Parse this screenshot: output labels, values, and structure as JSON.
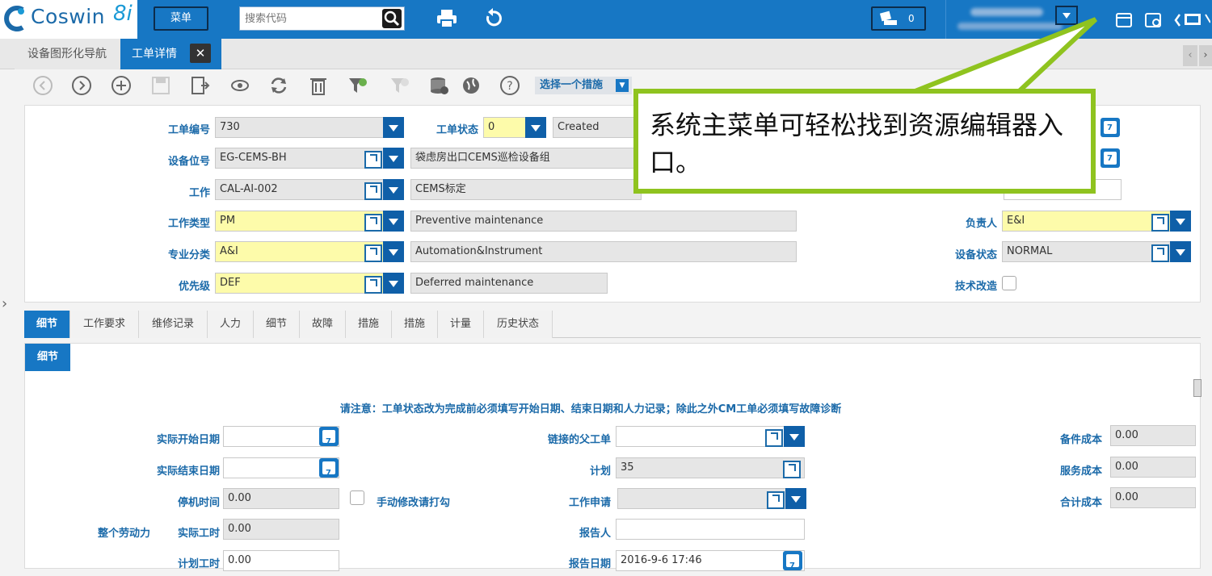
{
  "topbar": {
    "logo_text": "Coswin",
    "logo_version": "8i",
    "menu_label": "菜单",
    "search_placeholder": "搜索代码",
    "notification_count": "0"
  },
  "tabs": {
    "tab1": "设备图形化导航",
    "tab2": "工单详情",
    "close": "✕"
  },
  "toolbar": {
    "action_select": "选择一个措施"
  },
  "form": {
    "wo_number_label": "工单编号",
    "wo_number_value": "730",
    "wo_status_label": "工单状态",
    "wo_status_code": "0",
    "wo_status_text": "Created",
    "location_label": "设备位号",
    "location_code": "EG-CEMS-BH",
    "location_desc": "袋虑房出口CEMS巡检设备组",
    "job_label": "工作",
    "job_code": "CAL-AI-002",
    "job_desc": "CEMS标定",
    "job_type_label": "工作类型",
    "job_type_code": "PM",
    "job_type_desc": "Preventive maintenance",
    "discipline_label": "专业分类",
    "discipline_code": "A&I",
    "discipline_desc": "Automation&Instrument",
    "priority_label": "优先级",
    "priority_code": "DEF",
    "priority_desc": "Deferred maintenance",
    "owner_label": "负责人",
    "owner_value": "E&I",
    "equip_status_label": "设备状态",
    "equip_status_value": "NORMAL",
    "tech_mod_label": "技术改造"
  },
  "bottom_tabs": [
    "细节",
    "工作要求",
    "维修记录",
    "人力",
    "细节",
    "故障",
    "措施",
    "措施",
    "计量",
    "历史状态"
  ],
  "detail": {
    "subtab": "细节",
    "notice": "请注意：工单状态改为完成前必须填写开始日期、结束日期和人力记录；除此之外CM工单必须填写故障诊断",
    "actual_start_label": "实际开始日期",
    "actual_end_label": "实际结束日期",
    "downtime_label": "停机时间",
    "downtime_value": "0.00",
    "manual_check_label": "手动修改请打勾",
    "labor_group_label": "整个劳动力",
    "actual_hours_label": "实际工时",
    "actual_hours_value": "0.00",
    "plan_hours_label": "计划工时",
    "plan_hours_value": "0.00",
    "parent_wo_label": "链接的父工单",
    "plan_label": "计划",
    "plan_value": "35",
    "request_label": "工作申请",
    "reporter_label": "报告人",
    "report_date_label": "报告日期",
    "report_date_value": "2016-9-6 17:46",
    "parts_cost_label": "备件成本",
    "parts_cost_value": "0.00",
    "service_cost_label": "服务成本",
    "service_cost_value": "0.00",
    "total_cost_label": "合计成本",
    "total_cost_value": "0.00"
  },
  "callout": {
    "text": "系统主菜单可轻松找到资源编辑器入口。"
  },
  "colors": {
    "brand_blue": "#1777c4",
    "callout_green": "#8fc31f",
    "required_yellow": "#fdfbaa"
  }
}
